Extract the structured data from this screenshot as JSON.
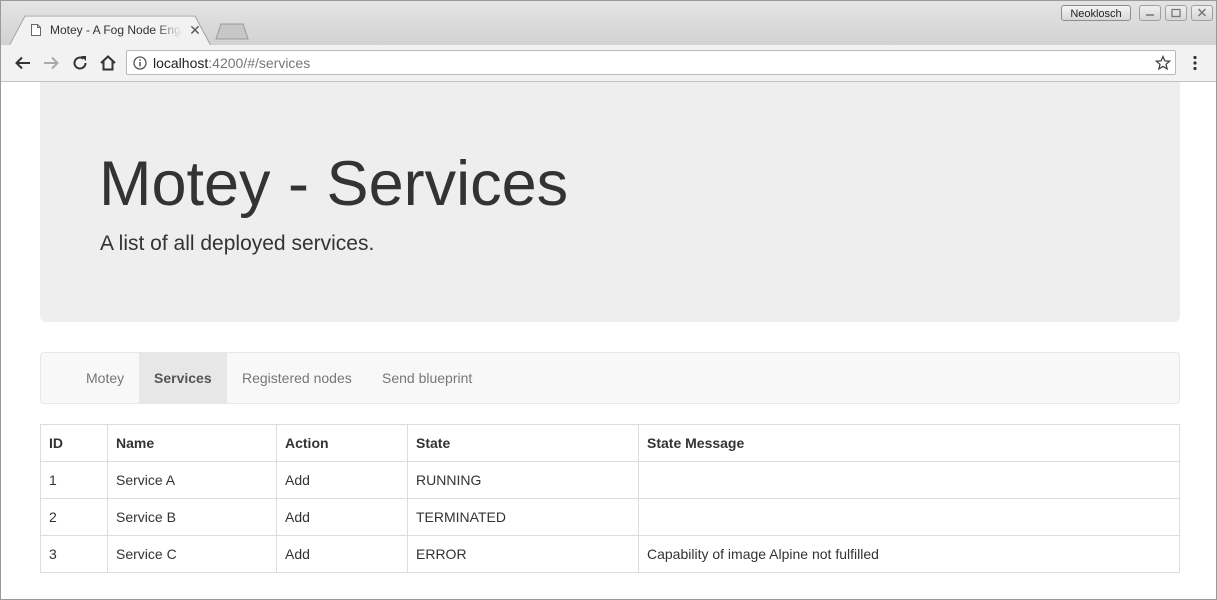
{
  "browser": {
    "tab_title": "Motey - A Fog Node Engine",
    "profile_name": "Neoklosch",
    "url_host": "localhost",
    "url_rest": ":4200/#/services"
  },
  "page": {
    "title": "Motey - Services",
    "subtitle": "A list of all deployed services."
  },
  "nav": {
    "items": [
      {
        "label": "Motey",
        "active": false
      },
      {
        "label": "Services",
        "active": true
      },
      {
        "label": "Registered nodes",
        "active": false
      },
      {
        "label": "Send blueprint",
        "active": false
      }
    ]
  },
  "table": {
    "headers": [
      "ID",
      "Name",
      "Action",
      "State",
      "State Message"
    ],
    "rows": [
      [
        "1",
        "Service A",
        "Add",
        "RUNNING",
        ""
      ],
      [
        "2",
        "Service B",
        "Add",
        "TERMINATED",
        ""
      ],
      [
        "3",
        "Service C",
        "Add",
        "ERROR",
        "Capability of image Alpine not fulfilled"
      ]
    ]
  },
  "icons": {
    "tab": "file-icon",
    "back": "back-arrow-icon",
    "forward": "forward-arrow-icon",
    "reload": "reload-icon",
    "home": "home-icon",
    "info": "info-icon",
    "bookmark": "star-icon",
    "menu": "kebab-menu-icon"
  }
}
